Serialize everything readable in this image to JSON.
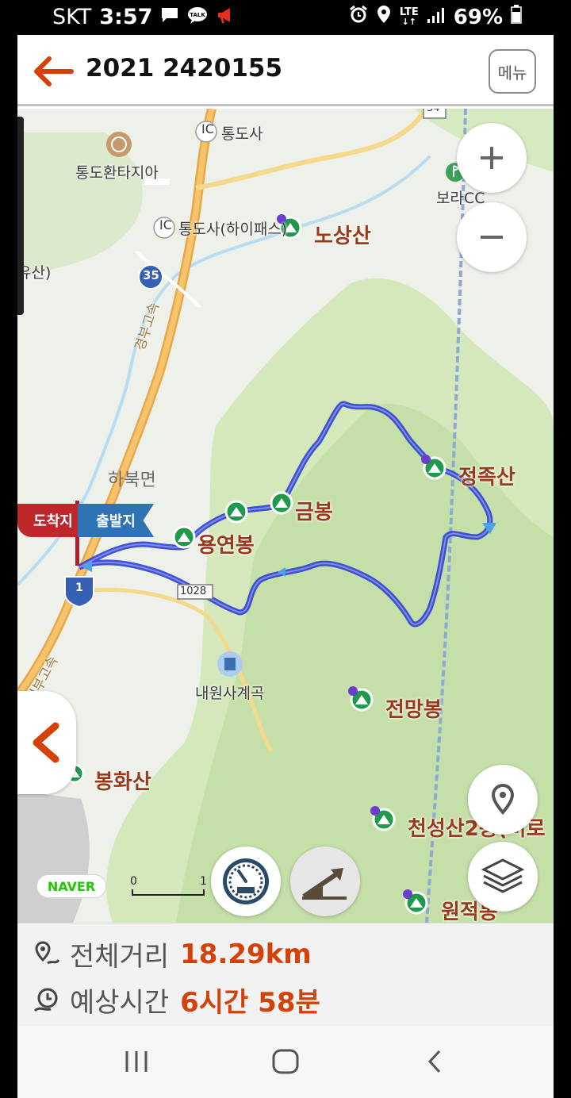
{
  "status_bar": {
    "carrier": "SKT",
    "time": "3:57",
    "network": "LTE",
    "battery": "69%"
  },
  "header": {
    "title": "2021 2420155",
    "menu_label": "메뉴"
  },
  "map": {
    "labels": {
      "ic_tongdosa": "통도사",
      "ic_tongdosa_hipass": "통도사(하이패스)",
      "tongdo_fantasia": "통도환타지아",
      "bora_cc": "보라CC",
      "route_34": "34",
      "route_35": "35",
      "route_1": "1",
      "route_1028": "1028",
      "ic": "IC",
      "left_edge_cut": "유산)",
      "hwy_label_top": "경부고속",
      "hwy_label_bottom": "경부고속",
      "habuk_myeon": "하북면",
      "naewonsa_valley": "내원사계곡"
    },
    "peaks": {
      "nosangsan": "노상산",
      "jeongjoksan": "정족산",
      "geumbong": "금봉",
      "yongyeonbong": "용연봉",
      "jeonmangbong": "전망봉",
      "bonghwasan": "봉화산",
      "cheonseongsan": "천성산2봉(비로",
      "wonjeokbong": "원적봉"
    },
    "flags": {
      "arrival": "도착지",
      "departure": "출발지"
    },
    "naver_logo": "NAVER",
    "scale_zero": "0",
    "scale_end": "1"
  },
  "route_info": {
    "distance_label": "전체거리",
    "distance_value": "18.29km",
    "time_label": "예상시간",
    "time_value": "6시간 58분"
  },
  "colors": {
    "accent": "#d4420a",
    "route": "#2d3fd0",
    "forest": "#d2e6b8",
    "road": "#f3c86a",
    "peak_marker": "#1f9a4c"
  }
}
